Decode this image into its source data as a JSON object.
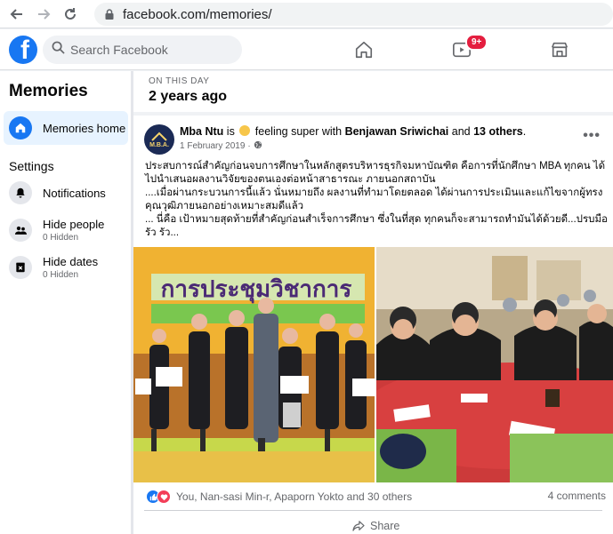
{
  "browser": {
    "url": "facebook.com/memories/"
  },
  "header": {
    "search_placeholder": "Search Facebook",
    "watch_badge": "9+"
  },
  "sidebar": {
    "title": "Memories",
    "home_label": "Memories home",
    "settings_heading": "Settings",
    "items": [
      {
        "label": "Notifications",
        "sub": ""
      },
      {
        "label": "Hide people",
        "sub": "0 Hidden"
      },
      {
        "label": "Hide dates",
        "sub": "0 Hidden"
      }
    ]
  },
  "day": {
    "label": "ON THIS DAY",
    "title": "2 years ago"
  },
  "post": {
    "author": "Mba Ntu",
    "is_word": "is",
    "feeling": "feeling super with",
    "tagged": "Benjawan Sriwichai",
    "and_word": "and",
    "others": "13 others",
    "date": "1 February 2019",
    "avatar_text": "M.B.A.",
    "text_lines": [
      "ประสบการณ์สำคัญก่อนจบการศึกษาในหลักสูตรบริหารธุรกิจมหาบัณฑิต คือการที่นักศึกษา MBA ทุกคน ได้ไปนำเสนอผลงานวิจัยของตนเองต่อหน้าสาธารณะ ภายนอกสถาบัน",
      "....เมื่อผ่านกระบวนการนี้แล้ว นั่นหมายถึง ผลงานที่ทำมาโดยตลอด ได้ผ่านการประเมินและแก้ไขจากผู้ทรงคุณวุฒิภายนอกอย่างเหมาะสมดีแล้ว",
      "... นี่คือ เป้าหมายสุดท้ายที่สำคัญก่อนสำเร็จการศึกษา ซึ่งในที่สุด ทุกคนก็จะสามารถทำมันได้ด้วยดี...ปรบมือรัว รัว..."
    ],
    "banner_text": "การประชุมวิชาการ",
    "reactions_text": "You, Nan-sasi Min-r, Apaporn Yokto and 30 others",
    "comments_text": "4 comments",
    "share_label": "Share"
  },
  "colors": {
    "brand": "#1877f2",
    "badge": "#e41e3f"
  }
}
